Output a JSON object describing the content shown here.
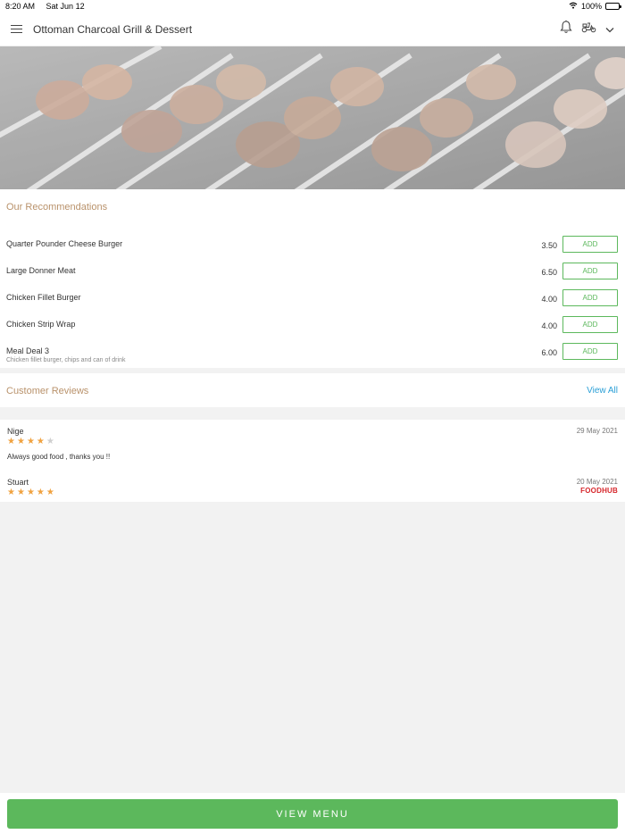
{
  "status_bar": {
    "time": "8:20 AM",
    "date": "Sat Jun 12",
    "battery": "100%"
  },
  "header": {
    "title": "Ottoman Charcoal Grill & Dessert"
  },
  "recommendations": {
    "title": "Our Recommendations",
    "add_label": "ADD",
    "items": [
      {
        "name": "Quarter Pounder Cheese Burger",
        "desc": "",
        "price": "3.50"
      },
      {
        "name": "Large Donner Meat",
        "desc": "",
        "price": "6.50"
      },
      {
        "name": "Chicken Fillet Burger",
        "desc": "",
        "price": "4.00"
      },
      {
        "name": "Chicken Strip Wrap",
        "desc": "",
        "price": "4.00"
      },
      {
        "name": "Meal Deal 3",
        "desc": "Chicken fillet burger, chips and can of drink",
        "price": "6.00"
      }
    ]
  },
  "reviews": {
    "title": "Customer Reviews",
    "view_all": "View All",
    "items": [
      {
        "name": "Nige",
        "date": "29 May 2021",
        "rating": 4,
        "text": "Always good food , thanks you !!"
      },
      {
        "name": "Stuart",
        "date": "20 May 2021",
        "rating": 5,
        "text": ""
      }
    ],
    "brand": "FOODHUB"
  },
  "footer": {
    "view_menu": "VIEW MENU"
  },
  "colors": {
    "accent_green": "#5cb85c",
    "section_title": "#b9926b",
    "link_blue": "#2a9fd6",
    "star": "#f0a240"
  }
}
